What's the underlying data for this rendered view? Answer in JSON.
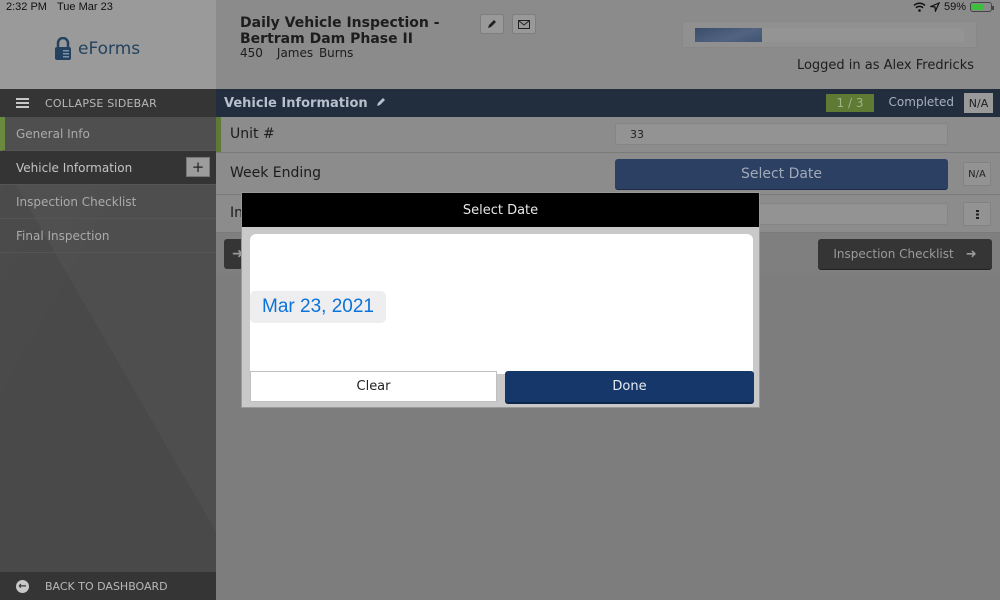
{
  "status_bar": {
    "time": "2:32 PM",
    "date": "Tue Mar 23",
    "battery_percent": "59%",
    "icons": [
      "wifi-icon",
      "location-arrow-icon",
      "battery-charging-icon"
    ]
  },
  "app": {
    "logo_text": "eForms",
    "logo_icon": "padlock-icon"
  },
  "header": {
    "title_line1": "Daily Vehicle Inspection -",
    "title_line2": "Bertram Dam Phase II",
    "form_number": "450",
    "assignee": "James  Burns",
    "edit_icon": "pencil-icon",
    "email_icon": "envelope-icon",
    "progress_fraction": 0.25,
    "logged_in": "Logged in as Alex Fredricks"
  },
  "sidebar": {
    "collapse_label": "COLLAPSE SIDEBAR",
    "items": [
      {
        "label": "General Info",
        "state": "completed"
      },
      {
        "label": "Vehicle Information",
        "state": "selected",
        "add_label": "+"
      },
      {
        "label": "Inspection Checklist",
        "state": "default"
      },
      {
        "label": "Final Inspection",
        "state": "default"
      }
    ],
    "back_label": "BACK TO DASHBOARD"
  },
  "section": {
    "title": "Vehicle Information",
    "count": "1 / 3",
    "completed_label": "Completed",
    "na_label": "N/A"
  },
  "fields": [
    {
      "label": "Unit #",
      "value": "33"
    },
    {
      "label": "Week Ending",
      "button_label": "Select Date",
      "na_label": "N/A"
    },
    {
      "label": "In",
      "value": ""
    }
  ],
  "navigation": {
    "prev_icon": "arrow-left-icon",
    "next_label": "Inspection Checklist",
    "next_icon": "arrow-right-icon"
  },
  "modal": {
    "title": "Select Date",
    "date_value": "Mar 23, 2021",
    "clear_label": "Clear",
    "done_label": "Done"
  }
}
